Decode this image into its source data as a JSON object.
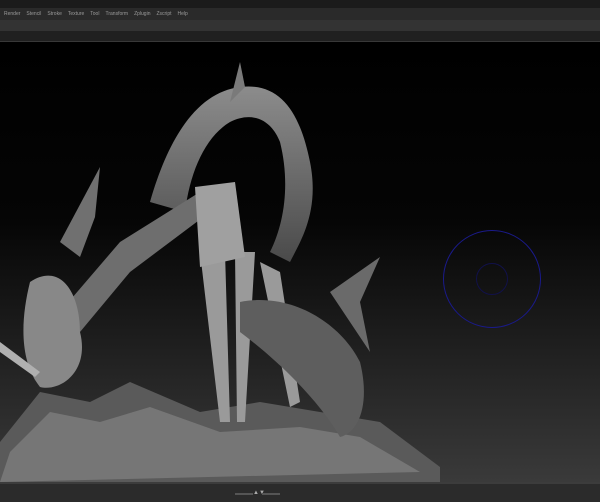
{
  "menu": [
    "Render",
    "Stencil",
    "Stroke",
    "Texture",
    "Tool",
    "Transform",
    "Zplugin",
    "Zscript",
    "Help"
  ],
  "colors": {
    "brush_ring": "#1a1a8a",
    "model": "#8a8a8a",
    "menu_text": "#9a9a9a"
  },
  "icons": {
    "brush_cursor": "brush-circle-icon",
    "nav": "navigation-arrows-icon"
  }
}
